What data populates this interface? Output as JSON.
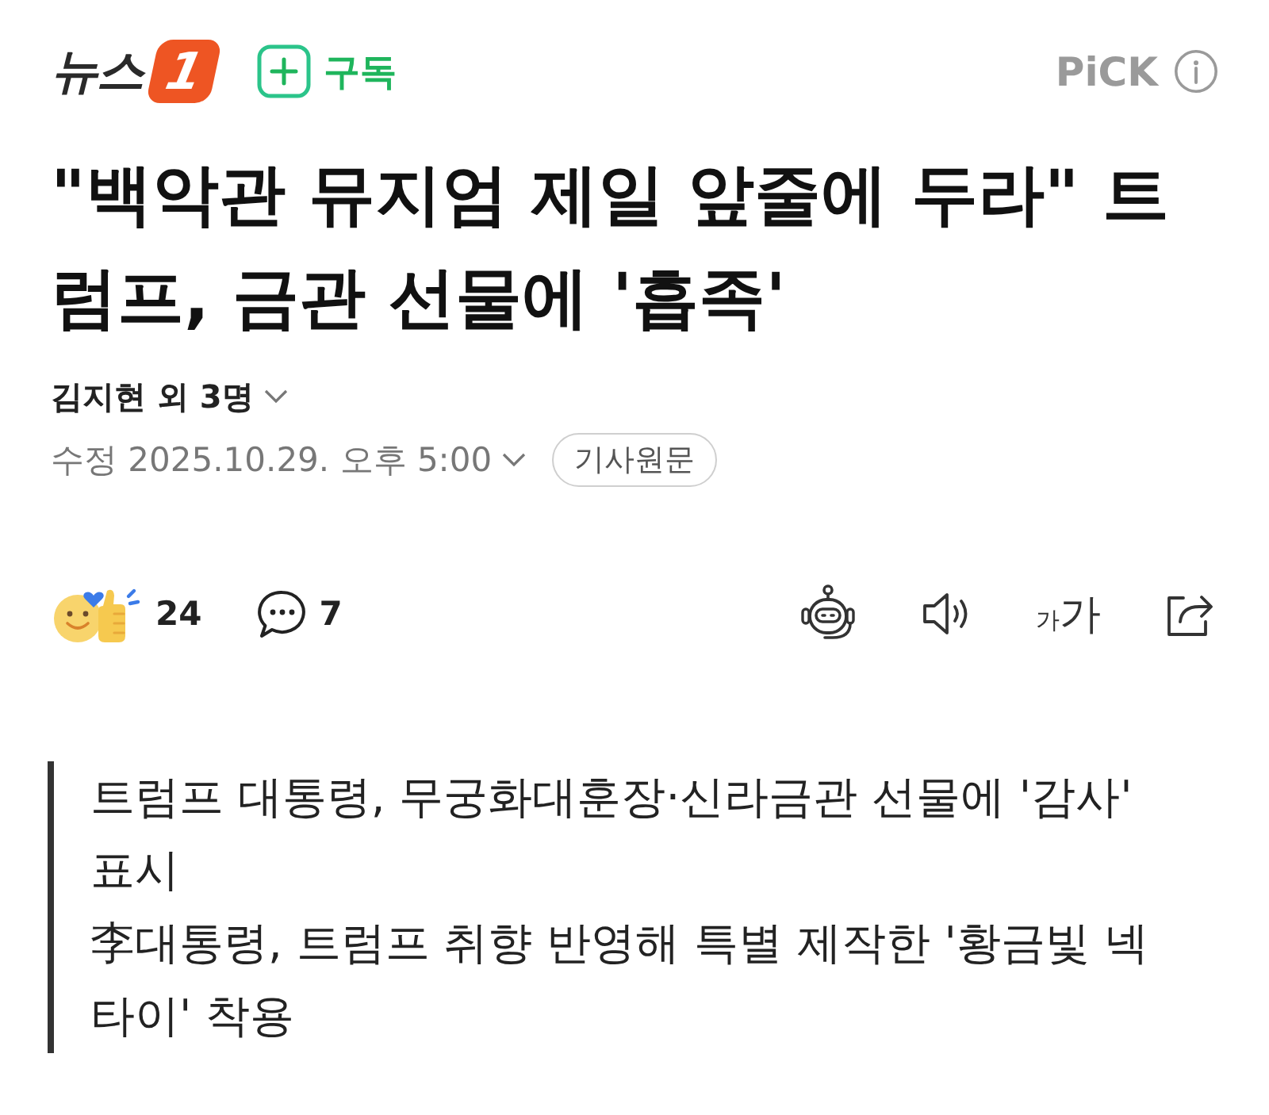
{
  "header": {
    "logo": {
      "text": "뉴스",
      "badge": "1"
    },
    "subscribe": {
      "label": "구독"
    },
    "pick": {
      "label": "PiCK"
    }
  },
  "article": {
    "title": "\"백악관 뮤지엄 제일 앞줄에 두라\" 트럼프, 금관 선물에 '흡족'",
    "byline": "김지현 외 3명",
    "timestamp": "수정 2025.10.29. 오후 5:00",
    "source_button": "기사원문"
  },
  "engagement": {
    "reactions": "24",
    "comments": "7",
    "font_size_button": {
      "small": "가",
      "large": "가"
    }
  },
  "summary": [
    "트럼프 대통령, 무궁화대훈장·신라금관 선물에 '감사' 표시",
    "李대통령, 트럼프 취향 반영해 특별 제작한 '황금빛 넥타이' 착용"
  ]
}
